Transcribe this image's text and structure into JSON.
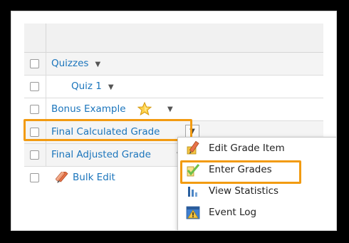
{
  "grid": {
    "rows": [
      {
        "label": "Quizzes",
        "has_caret": true
      },
      {
        "label": "Quiz 1",
        "has_caret": true
      },
      {
        "label": "Bonus Example",
        "has_caret": true,
        "icon": "star-icon"
      },
      {
        "label": "Final Calculated Grade",
        "has_dropdown": true
      },
      {
        "label": "Final Adjusted Grade"
      },
      {
        "label": "Bulk Edit",
        "icon": "pencil-icon"
      }
    ]
  },
  "menu": {
    "items": [
      {
        "label": "Edit Grade Item",
        "icon": "pencil-ruler-icon"
      },
      {
        "label": "Enter Grades",
        "icon": "checkmark-pencil-icon"
      },
      {
        "label": "View Statistics",
        "icon": "bar-chart-icon"
      },
      {
        "label": "Event Log",
        "icon": "warning-icon"
      }
    ]
  },
  "colors": {
    "link": "#1b75bc",
    "highlight": "#f29b11",
    "background": "#000000"
  }
}
